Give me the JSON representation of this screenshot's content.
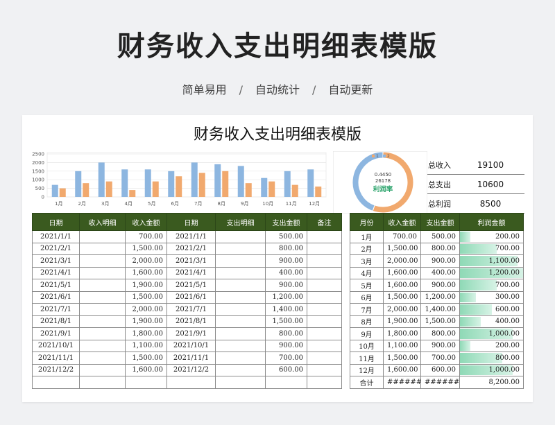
{
  "banner": {
    "title": "财务收入支出明细表模版",
    "tags": [
      "简单易用",
      "自动统计",
      "自动更新"
    ],
    "separator": "/"
  },
  "sheet": {
    "title": "财务收入支出明细表模版"
  },
  "chart_data": [
    {
      "type": "bar",
      "categories": [
        "1月",
        "2月",
        "3月",
        "4月",
        "5月",
        "6月",
        "7月",
        "8月",
        "9月",
        "10月",
        "11月",
        "12月"
      ],
      "series": [
        {
          "values": [
            700,
            1500,
            2000,
            1600,
            1600,
            1500,
            2000,
            1900,
            1800,
            1100,
            1500,
            1600
          ],
          "color": "#8db6e0"
        },
        {
          "values": [
            500,
            800,
            900,
            400,
            900,
            1200,
            1400,
            1500,
            800,
            900,
            700,
            600
          ],
          "color": "#f1a96e"
        }
      ],
      "y_ticks": [
        "0",
        "500",
        "1000",
        "1500",
        "2000",
        "2500"
      ],
      "ylim": [
        0,
        2500
      ]
    },
    {
      "type": "pie",
      "values": [
        10600,
        8500
      ],
      "colors": [
        "#f1a96e",
        "#8db6e0"
      ],
      "legend": [
        "1",
        "2"
      ],
      "center_text": [
        "0.4450",
        "26178"
      ],
      "label": "利润率"
    }
  ],
  "summary": [
    {
      "label": "总收入",
      "value": "19100"
    },
    {
      "label": "总支出",
      "value": "10600"
    },
    {
      "label": "总利润",
      "value": "8500"
    }
  ],
  "ledger": {
    "headers": [
      "日期",
      "收入明细",
      "收入金额",
      "日期",
      "支出明细",
      "支出金额",
      "备注"
    ],
    "rows": [
      [
        "2021/1/1",
        "",
        "700.00",
        "2021/1/1",
        "",
        "500.00",
        ""
      ],
      [
        "2021/2/1",
        "",
        "1,500.00",
        "2021/2/1",
        "",
        "800.00",
        ""
      ],
      [
        "2021/3/1",
        "",
        "2,000.00",
        "2021/3/1",
        "",
        "900.00",
        ""
      ],
      [
        "2021/4/1",
        "",
        "1,600.00",
        "2021/4/1",
        "",
        "400.00",
        ""
      ],
      [
        "2021/5/1",
        "",
        "1,900.00",
        "2021/5/1",
        "",
        "900.00",
        ""
      ],
      [
        "2021/6/1",
        "",
        "1,500.00",
        "2021/6/1",
        "",
        "1,200.00",
        ""
      ],
      [
        "2021/7/1",
        "",
        "2,000.00",
        "2021/7/1",
        "",
        "1,400.00",
        ""
      ],
      [
        "2021/8/1",
        "",
        "1,900.00",
        "2021/8/1",
        "",
        "1,500.00",
        ""
      ],
      [
        "2021/9/1",
        "",
        "1,800.00",
        "2021/9/1",
        "",
        "800.00",
        ""
      ],
      [
        "2021/10/1",
        "",
        "1,100.00",
        "2021/10/1",
        "",
        "900.00",
        ""
      ],
      [
        "2021/11/1",
        "",
        "1,500.00",
        "2021/11/1",
        "",
        "700.00",
        ""
      ],
      [
        "2021/12/2",
        "",
        "1,600.00",
        "2021/12/2",
        "",
        "600.00",
        ""
      ],
      [
        "",
        "",
        "",
        "",
        "",
        "",
        ""
      ]
    ]
  },
  "monthly": {
    "headers": [
      "月份",
      "收入金额",
      "支出金额",
      "利润金额"
    ],
    "rows": [
      {
        "month": "1月",
        "income": "700.00",
        "expense": "500.00",
        "profit": "200.00",
        "level": 0.167
      },
      {
        "month": "2月",
        "income": "1,500.00",
        "expense": "800.00",
        "profit": "700.00",
        "level": 0.583
      },
      {
        "month": "3月",
        "income": "2,000.00",
        "expense": "900.00",
        "profit": "1,100.00",
        "level": 0.917
      },
      {
        "month": "4月",
        "income": "1,600.00",
        "expense": "400.00",
        "profit": "1,200.00",
        "level": 1.0
      },
      {
        "month": "5月",
        "income": "1,600.00",
        "expense": "900.00",
        "profit": "700.00",
        "level": 0.583
      },
      {
        "month": "6月",
        "income": "1,500.00",
        "expense": "1,200.00",
        "profit": "300.00",
        "level": 0.25
      },
      {
        "month": "7月",
        "income": "2,000.00",
        "expense": "1,400.00",
        "profit": "600.00",
        "level": 0.5
      },
      {
        "month": "8月",
        "income": "1,900.00",
        "expense": "1,500.00",
        "profit": "400.00",
        "level": 0.333
      },
      {
        "month": "9月",
        "income": "1,800.00",
        "expense": "800.00",
        "profit": "1,000.00",
        "level": 0.833
      },
      {
        "month": "10月",
        "income": "1,100.00",
        "expense": "900.00",
        "profit": "200.00",
        "level": 0.167
      },
      {
        "month": "11月",
        "income": "1,500.00",
        "expense": "700.00",
        "profit": "800.00",
        "level": 0.667
      },
      {
        "month": "12月",
        "income": "1,600.00",
        "expense": "600.00",
        "profit": "1,000.00",
        "level": 0.833
      }
    ],
    "total": {
      "label": "合计",
      "income": "#########",
      "expense": "#########",
      "profit": "8,200.00"
    }
  }
}
